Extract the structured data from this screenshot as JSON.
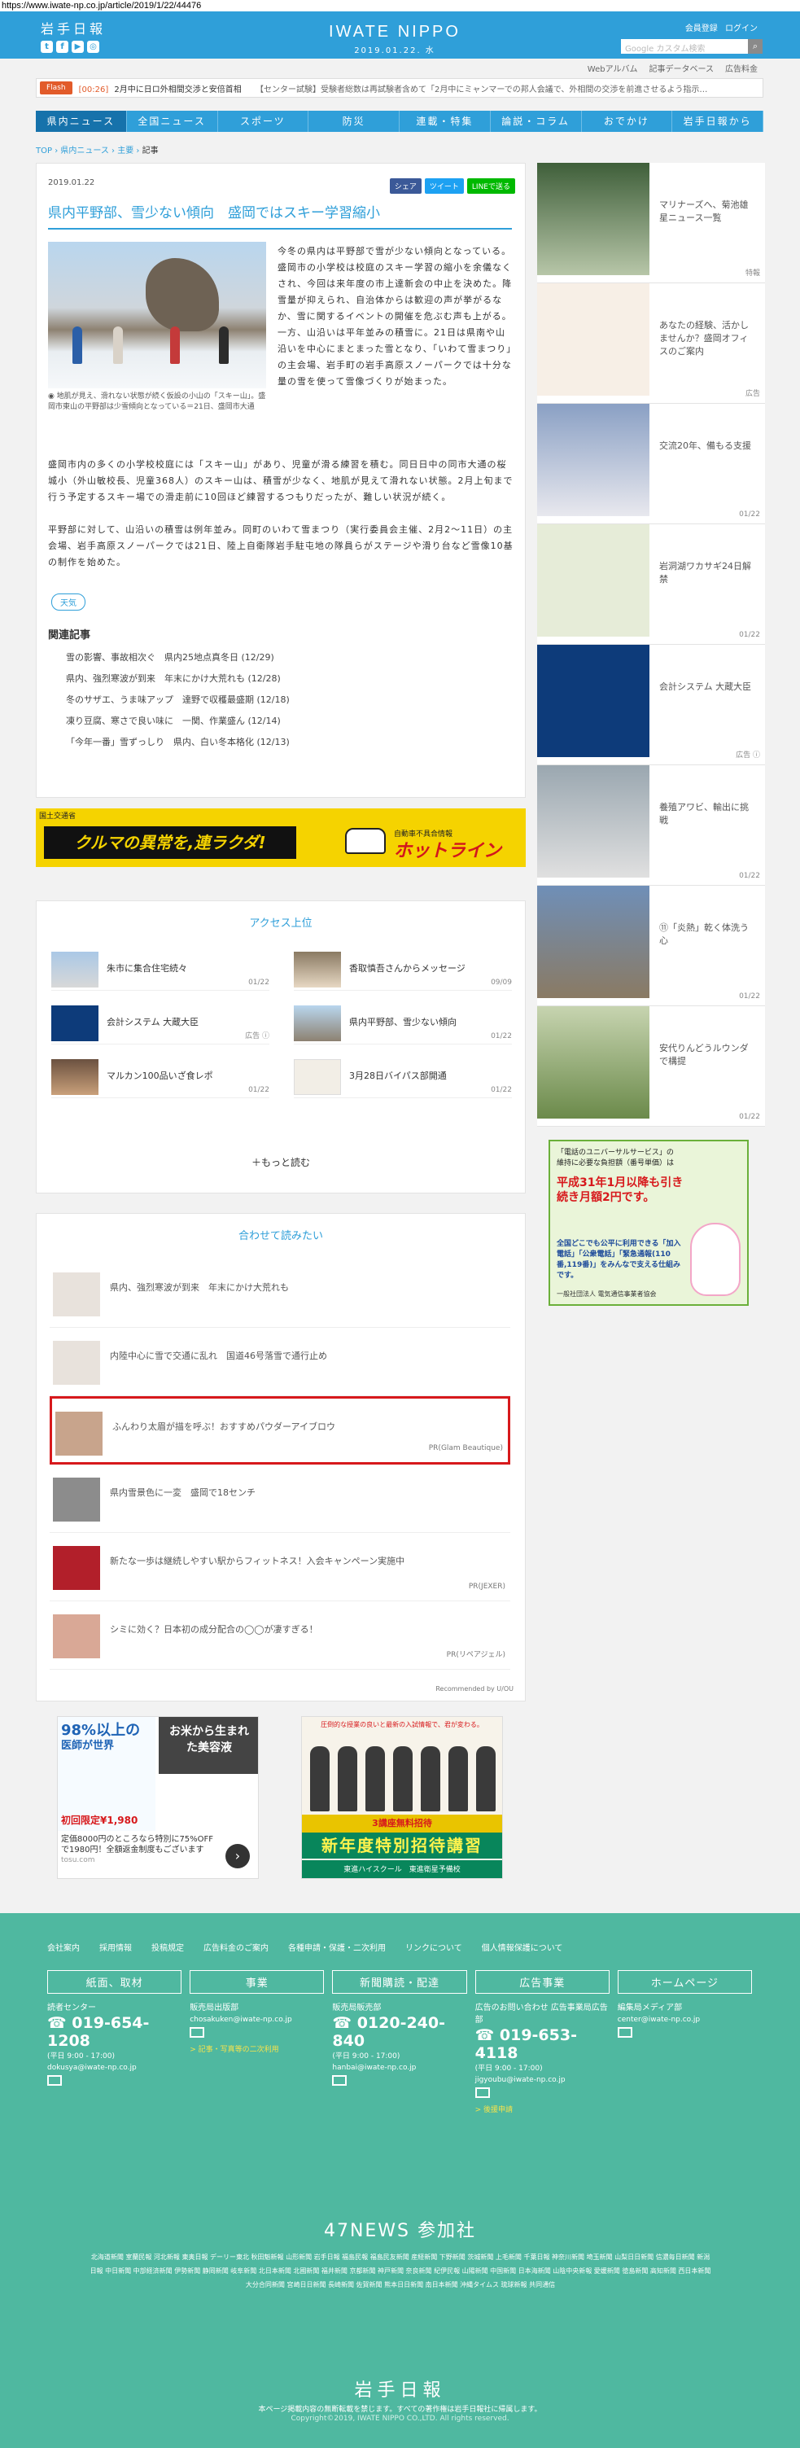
{
  "url": "https://www.iwate-np.co.jp/article/2019/1/22/44476",
  "header": {
    "logo_small": "岩手日報",
    "brand": "IWATE NIPPO",
    "date": "2019.01.22. 水",
    "links": [
      "会員登録",
      "ログイン"
    ],
    "search_placeholder": "Google カスタム検索",
    "sub_links": [
      "Webアルバム",
      "記事データベース",
      "広告料金"
    ]
  },
  "flash": {
    "label": "Flash",
    "time": "[00:26]",
    "text": "2月中に日ロ外相間交渉と安倍首相",
    "text2": "【センター試験】受験者総数は再試験者含めて「2月中にミャンマーでの邦人会議で、外相間の交渉を前進させるよう指示…"
  },
  "nav": [
    "県内ニュース",
    "全国ニュース",
    "スポーツ",
    "防災",
    "連載・特集",
    "論説・コラム",
    "おでかけ",
    "岩手日報から"
  ],
  "breadcrumb": [
    "TOP",
    "県内ニュース",
    "主要",
    "記事"
  ],
  "article": {
    "date": "2019.01.22",
    "share": [
      "シェア",
      "ツイート",
      "LINEで送る"
    ],
    "title": "県内平野部、雪少ない傾向　盛岡ではスキー学習縮小",
    "caption": "地肌が見え、滑れない状態が続く仮設の小山の「スキー山」。盛岡市東山の平野部は少雪傾向となっている＝21日、盛岡市大通",
    "p1": "今冬の県内は平野部で雪が少ない傾向となっている。盛岡市の小学校は校庭のスキー学習の縮小を余儀なくされ、今回は来年度の市上達新会の中止を決めた。降雪量が抑えられ、自治体からは歓迎の声が挙がるなか、雪に関するイベントの開催を危ぶむ声も上がる。一方、山沿いは平年並みの積雪に。21日は県南や山沿いを中心にまとまった雪となり、「いわて雪まつり」の主会場、岩手町の岩手高原スノーパークでは十分な量の雪を使って雪像づくりが始まった。",
    "p2": "盛岡市内の多くの小学校校庭には「スキー山」があり、児童が滑る練習を積む。同日日中の同市大通の桜城小（外山敏校長、児童368人）のスキー山は、積雪が少なく、地肌が見えて滑れない状態。2月上旬まで行う予定するスキー場での滑走前に10回ほど練習するつもりだったが、難しい状況が続く。",
    "p3": "平野部に対して、山沿いの積雪は例年並み。同町のいわて雪まつり（実行委員会主催、2月2〜11日）の主会場、岩手高原スノーパークでは21日、陸上自衛隊岩手駐屯地の隊員らがステージや滑り台など雪像10基の制作を始めた。",
    "tag": "天気",
    "related_title": "関連記事",
    "related": [
      "雪の影響、事故相次ぐ　県内25地点真冬日 (12/29)",
      "県内、強烈寒波が到来　年末にかけ大荒れも (12/28)",
      "冬のサザエ、うま味アップ　達野で収穫最盛期 (12/18)",
      "凍り豆腐、寒さで良い味に　一関、作業盛ん (12/14)",
      "「今年一番」雪ずっしり　県内、白い冬本格化 (12/13)"
    ]
  },
  "ad_banner": {
    "company": "国土交通省",
    "main": "クルマの異常を,連ラクダ!",
    "logo_small": "自動車不具合情報",
    "logo": "ホットライン"
  },
  "access": {
    "title": "アクセス上位",
    "items": [
      {
        "title": "朱市に集合住宅続々",
        "date": "01/22"
      },
      {
        "title": "香取慎吾さんからメッセージ",
        "date": "09/09"
      },
      {
        "title": "会計システム 大蔵大臣",
        "date": "広告 ⓘ"
      },
      {
        "title": "県内平野部、雪少ない傾向",
        "date": "01/22"
      },
      {
        "title": "マルカン100品いざ食レポ",
        "date": "01/22"
      },
      {
        "title": "3月28日バイパス部開通",
        "date": "01/22"
      }
    ],
    "more": "＋もっと読む"
  },
  "recommend": {
    "title": "合わせて読みたい",
    "items": [
      {
        "title": "県内、強烈寒波が到来　年末にかけ大荒れも",
        "pr": ""
      },
      {
        "title": "内陸中心に雪で交通に乱れ　国道46号落雪で通行止め",
        "pr": ""
      },
      {
        "title": "ふんわり太眉が描を呼ぶ！おすすめパウダーアイブロウ",
        "pr": "PR(Glam Beautique)"
      },
      {
        "title": "県内雪景色に一変　盛岡で18センチ",
        "pr": ""
      },
      {
        "title": "新たな一歩は継続しやすい駅からフィットネス！入会キャンペーン実施中",
        "pr": "PR(JEXER)"
      },
      {
        "title": "シミに効く？日本初の成分配合の◯◯が凄すぎる！",
        "pr": "PR(リペアジェル)"
      }
    ],
    "footer": "Recommended by U/OU"
  },
  "bottom_ads": {
    "a_pct": "98%以上の",
    "a_line": "医師が世界",
    "a_price": "初回限定¥1,980",
    "a_right": "お米から生まれた美容液",
    "a_foot": "定価8000円のところなら特別に75%OFFで1980円！全額返金制度もございます",
    "a_src": "tosu.com",
    "b_top": "圧倒的な授業の良いと最新の入試情報で、君が変わる。",
    "b_band": "3講座無料招待",
    "b_big": "新年度特別招待講習",
    "b_bottom": "東進ハイスクール　東進衛星予備校"
  },
  "sidebar": {
    "items": [
      {
        "title": "マリナーズへ、菊池雄星ニュース一覧",
        "meta": "特報"
      },
      {
        "title": "あなたの経験、活かしませんか？盛岡オフィスのご案内",
        "meta": "広告"
      },
      {
        "title": "交流20年、備もる支援",
        "meta": "01/22"
      },
      {
        "title": "岩洞湖ワカサギ24日解禁",
        "meta": "01/22"
      },
      {
        "title": "会計システム 大蔵大臣",
        "meta": "広告 ⓘ"
      },
      {
        "title": "養殖アワビ、輸出に挑戦",
        "meta": "01/22"
      },
      {
        "title": "⑪「炎熱」乾く体洗う心",
        "meta": "01/22"
      },
      {
        "title": "安代りんどうルウンダで構提",
        "meta": "01/22"
      }
    ],
    "ad_top": "「電話のユニバーサルサービス」の維持に必要な負担額（番号単価）は",
    "ad_red": "平成31年1月以降も引き続き月額2円です。",
    "ad_box": "全国どこでも公平に利用できる「加入電話」「公衆電話」「緊急通報(110番,119番)」をみんなで支える仕組みです。",
    "ad_org": "一般社団法人 電気通信事業者協会"
  },
  "footer": {
    "links": [
      "会社案内",
      "採用情報",
      "投稿規定",
      "広告料金のご案内",
      "各種申請・保護・二次利用",
      "リンクについて",
      "個人情報保護について"
    ],
    "cols": [
      {
        "h": "紙面、取材",
        "sub": "読者センター",
        "phone": "019-654-1208",
        "hours": "(平日 9:00 - 17:00)",
        "mail": "dokusya@iwate-np.co.jp",
        "link": ""
      },
      {
        "h": "事業",
        "sub": "販売局出版部",
        "phone": "",
        "hours": "",
        "mail": "chosakuken@iwate-np.co.jp",
        "link": "> 記事・写真等の二次利用"
      },
      {
        "h": "新聞購読・配達",
        "sub": "販売局販売部",
        "phone": "0120-240-840",
        "hours": "(平日 9:00 - 17:00)",
        "mail": "hanbai@iwate-np.co.jp",
        "link": ""
      },
      {
        "h": "広告事業",
        "sub": "広告のお問い合わせ 広告事業局広告部",
        "phone": "019-653-4118",
        "hours": "(平日 9:00 - 17:00)",
        "mail": "jigyoubu@iwate-np.co.jp",
        "link": "> 後援申請"
      },
      {
        "h": "ホームページ",
        "sub": "編集局メディア部",
        "phone": "",
        "hours": "",
        "mail": "center@iwate-np.co.jp",
        "link": ""
      }
    ],
    "news47": "47NEWS 参加社",
    "news47_list": "北海道新聞 室蘭民報 河北新報 東奥日報 デーリー東北 秋田魁新報 山形新聞 岩手日報 福島民報 福島民友新聞 産経新聞 下野新聞 茨城新聞 上毛新聞 千葉日報 神奈川新聞 埼玉新聞 山梨日日新聞 信濃毎日新聞 新潟日報 中日新聞 中部経済新聞 伊勢新聞 静岡新聞 岐阜新聞 北日本新聞 北國新聞 福井新聞 京都新聞 神戸新聞 奈良新聞 紀伊民報 山陽新聞 中国新聞 日本海新聞 山陰中央新報 愛媛新聞 徳島新聞 高知新聞 西日本新聞 大分合同新聞 宮崎日日新聞 長崎新聞 佐賀新聞 熊本日日新聞 南日本新聞 沖縄タイムス 琉球新報 共同通信",
    "logo": "岩手日報",
    "note": "本ページ掲載内容の無断転載を禁じます。すべての著作権は岩手日報社に帰属します。",
    "copy": "Copyright©2019, IWATE NIPPO CO.,LTD. All rights reserved."
  }
}
